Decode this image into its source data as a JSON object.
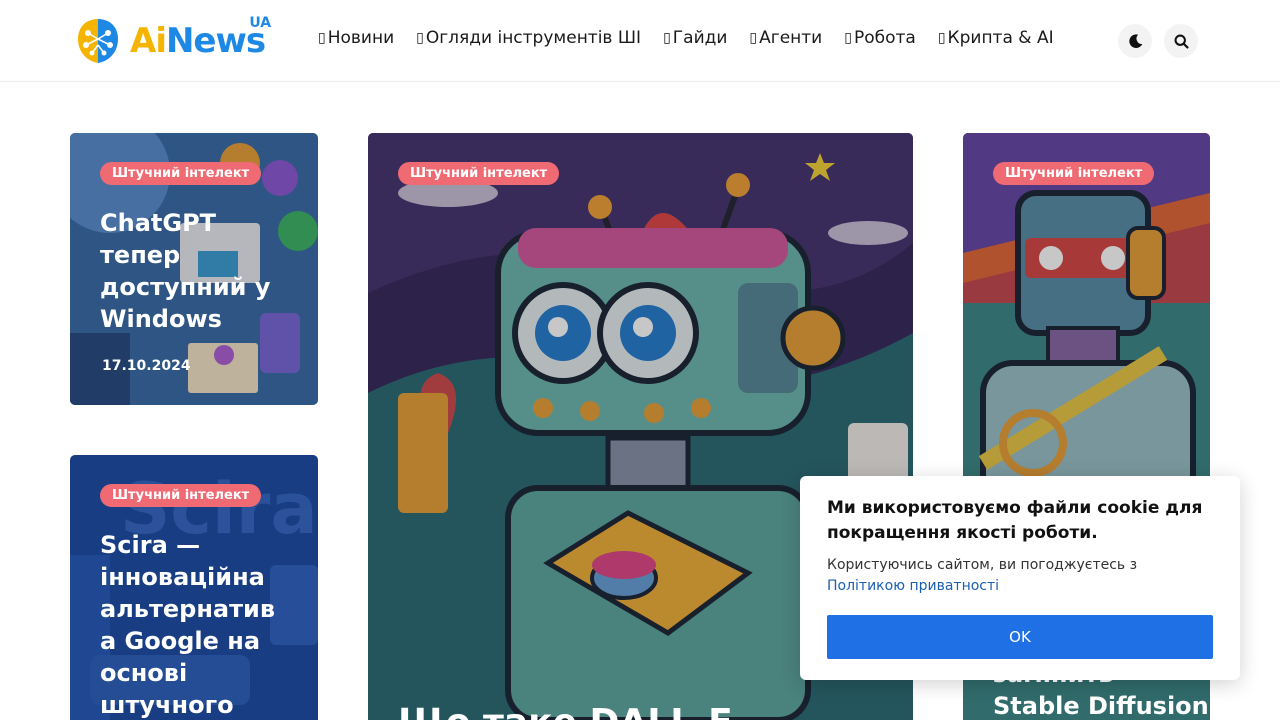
{
  "brand": {
    "ai": "Ai",
    "news": "News",
    "ua": "UA"
  },
  "nav": [
    {
      "icon": "box-icon",
      "glyph": "▯",
      "label": "Новини"
    },
    {
      "icon": "box-icon",
      "glyph": "▯",
      "label": "Огляди інструментів ШІ"
    },
    {
      "icon": "box-icon",
      "glyph": "▯",
      "label": "Гайди"
    },
    {
      "icon": "box-icon",
      "glyph": "▯",
      "label": "Агенти"
    },
    {
      "icon": "box-icon",
      "glyph": "▯",
      "label": "Робота"
    },
    {
      "icon": "box-icon",
      "glyph": "▯",
      "label": "Крипта & AI"
    }
  ],
  "header_buttons": {
    "theme_icon": "moon-icon",
    "search_icon": "search-icon"
  },
  "cards": [
    {
      "tag": "Штучний інтелект",
      "title_lines": [
        "ChatGPT",
        "тепер",
        "доступний у",
        "Windows"
      ],
      "date": "17.10.2024"
    },
    {
      "tag": "Штучний інтелект",
      "title_lines": [
        "Scira —",
        "інноваційна",
        "альтернатив",
        "а Google на",
        "основі",
        "штучного"
      ]
    },
    {
      "tag": "Штучний інтелект",
      "title_partial": "Що таке DALL-E"
    },
    {
      "tag": "Штучний інтелект",
      "title_lines": [
        "замінить",
        "Stable Diffusion"
      ]
    }
  ],
  "cookie": {
    "title": "Ми використовуємо файли cookie для покращення якості роботи.",
    "text": "Користуючись сайтом, ви погоджуєтесь з",
    "link": "Політикою приватності",
    "ok": "OK"
  },
  "colors": {
    "tag_bg": "#f06a73",
    "accent": "#1f6fe5",
    "logo_yellow": "#f4b400",
    "logo_blue": "#1e88e5"
  }
}
